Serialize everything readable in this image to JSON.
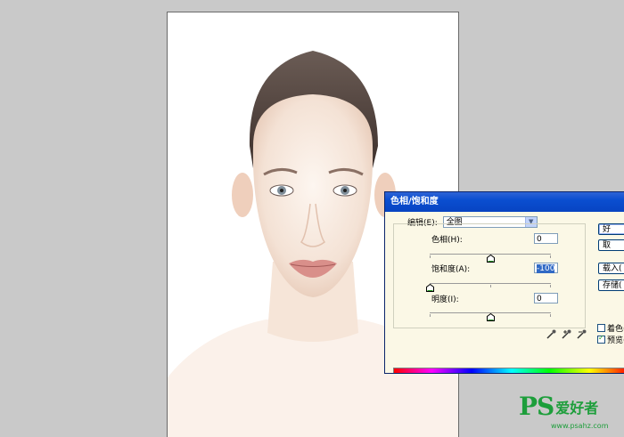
{
  "dialog": {
    "title": "色相/饱和度",
    "edit_label": "编辑(E):",
    "edit_value": "全图",
    "hue": {
      "label": "色相(H):",
      "value": "0",
      "level": 0.5
    },
    "saturation": {
      "label": "饱和度(A):",
      "value": "-100",
      "level": 0.0
    },
    "lightness": {
      "label": "明度(I):",
      "value": "0",
      "level": 0.5
    },
    "buttons": {
      "ok": "好",
      "cancel": "取",
      "load": "载入(",
      "save": "存储("
    },
    "colorize_label": "着色(",
    "colorize_checked": false,
    "preview_label": "预览(",
    "preview_checked": true
  },
  "watermark": {
    "logo": "PS",
    "cn": "爱好者",
    "url": "www.psahz.com"
  },
  "colors": {
    "titlebar": "#0a4ed0",
    "dialog_bg": "#fbf8e6",
    "workspace": "#c9c9c9",
    "accent": "#1d9e3b"
  }
}
